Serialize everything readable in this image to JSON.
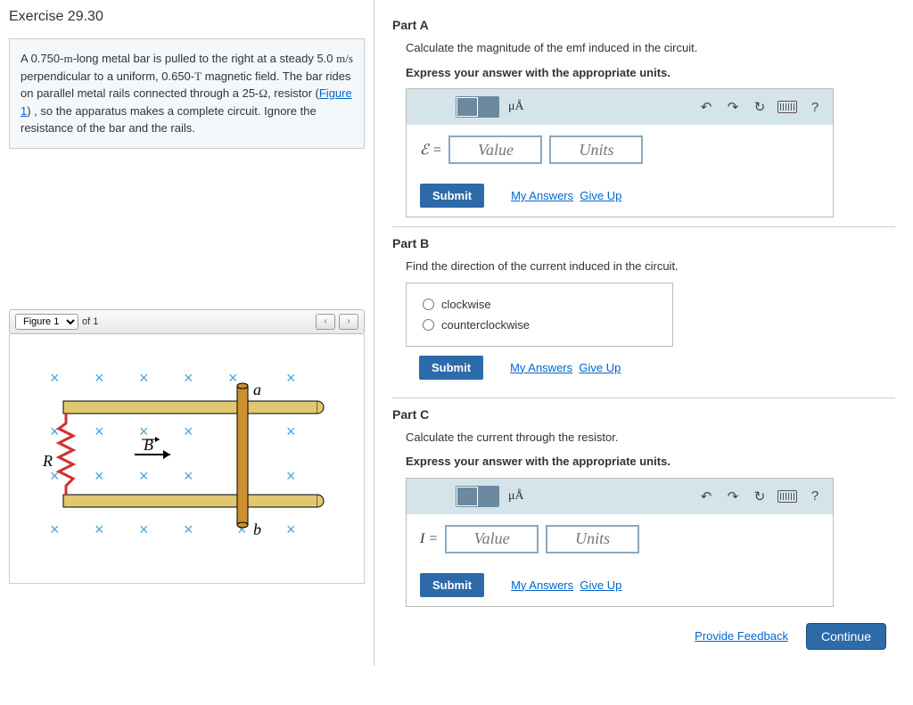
{
  "exercise_title": "Exercise 29.30",
  "problem_html": "A 0.750-<span class='math'>m</span>-long metal bar is pulled to the right at a steady 5.0 <span class='math'>m/s</span> perpendicular to a uniform, 0.650-<span class='math'>T</span> magnetic field. The bar rides on parallel metal rails connected through a 25-<span class='math'>Ω</span>, resistor (<span class='link-blue' data-name='figure-link' data-interactable='true'>Figure 1</span>) , so the apparatus makes a complete circuit. Ignore the resistance of the bar and the rails.",
  "figure": {
    "name": "Figure 1",
    "of_text": "of 1",
    "labels": {
      "a": "a",
      "b": "b",
      "R": "R",
      "B": "B"
    }
  },
  "toolbar": {
    "mua": "μÅ",
    "undo": "↶",
    "redo": "↷",
    "reset": "↻",
    "help": "?"
  },
  "partA": {
    "header": "Part A",
    "prompt": "Calculate the magnitude of the emf induced in the circuit.",
    "instruction": "Express your answer with the appropriate units.",
    "var_label": "ℰ =",
    "value_ph": "Value",
    "units_ph": "Units",
    "submit": "Submit",
    "my_answers": "My Answers",
    "give_up": "Give Up"
  },
  "partB": {
    "header": "Part B",
    "prompt": "Find the direction of the current induced in the circuit.",
    "opt1": "clockwise",
    "opt2": "counterclockwise",
    "submit": "Submit",
    "my_answers": "My Answers",
    "give_up": "Give Up"
  },
  "partC": {
    "header": "Part C",
    "prompt": "Calculate the current through the resistor.",
    "instruction": "Express your answer with the appropriate units.",
    "var_label": "I =",
    "value_ph": "Value",
    "units_ph": "Units",
    "submit": "Submit",
    "my_answers": "My Answers",
    "give_up": "Give Up"
  },
  "footer": {
    "feedback": "Provide Feedback",
    "continue": "Continue"
  }
}
